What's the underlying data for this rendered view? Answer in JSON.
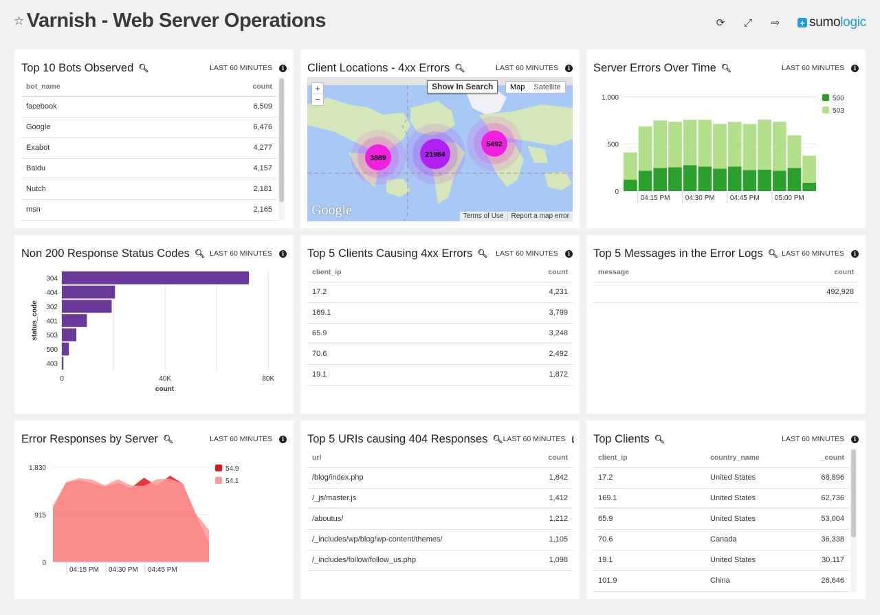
{
  "header": {
    "title": "Varnish - Web Server Operations",
    "star_icon": "star-outline-icon",
    "tools": [
      {
        "name": "refresh",
        "icon": "refresh-icon",
        "glyph": "⟳"
      },
      {
        "name": "fullscreen",
        "icon": "expand-icon",
        "glyph": "⤢"
      },
      {
        "name": "exit",
        "icon": "sign-out-icon",
        "glyph": "⇨"
      }
    ],
    "logo": {
      "prefix": "sumo",
      "suffix": "logic",
      "plus": "+"
    }
  },
  "time_range": "LAST 60 MINUTES",
  "panels": {
    "bots": {
      "title": "Top 10 Bots Observed",
      "columns": [
        "bot_name",
        "count"
      ],
      "rows": [
        [
          "facebook",
          "6,509"
        ],
        [
          "Google",
          "6,476"
        ],
        [
          "Exabot",
          "4,277"
        ],
        [
          "Baidu",
          "4,157"
        ],
        [
          "Nutch",
          "2,181"
        ],
        [
          "msn",
          "2,165"
        ]
      ]
    },
    "map": {
      "title": "Client Locations - 4xx Errors",
      "show_in_search": "Show In Search",
      "map_type": [
        "Map",
        "Satellite"
      ],
      "zoom_in": "+",
      "zoom_out": "−",
      "google": "Google",
      "terms": "Terms of Use",
      "report": "Report a map error",
      "clusters": [
        {
          "label": "3889",
          "color": "#f020e0"
        },
        {
          "label": "21984",
          "color": "#b020f0"
        },
        {
          "label": "5492",
          "color": "#f020e0"
        }
      ]
    },
    "server_errors": {
      "title": "Server Errors Over Time"
    },
    "status_codes": {
      "title": "Non 200 Response Status Codes"
    },
    "clients_4xx": {
      "title": "Top 5 Clients Causing 4xx Errors",
      "columns": [
        "client_ip",
        "count"
      ],
      "rows": [
        [
          "17.2",
          "4,231"
        ],
        [
          "169.1",
          "3,799"
        ],
        [
          "65.9",
          "3,248"
        ],
        [
          "70.6",
          "2,492"
        ],
        [
          "19.1",
          "1,872"
        ]
      ]
    },
    "error_messages": {
      "title": "Top 5 Messages in the Error Logs",
      "columns": [
        "message",
        "count"
      ],
      "rows": [
        [
          "",
          "492,928"
        ]
      ]
    },
    "error_by_server": {
      "title": "Error Responses by Server"
    },
    "uris_404": {
      "title": "Top 5 URIs causing 404 Responses",
      "columns": [
        "url",
        "count"
      ],
      "rows": [
        [
          "/blog/index.php",
          "1,842"
        ],
        [
          "/_js/master.js",
          "1,412"
        ],
        [
          "/aboutus/",
          "1,212"
        ],
        [
          "/_includes/wp/blog/wp-content/themes/",
          "1,105"
        ],
        [
          "/_includes/follow/follow_us.php",
          "1,098"
        ]
      ]
    },
    "top_clients": {
      "title": "Top Clients",
      "columns": [
        "client_ip",
        "country_name",
        "_count"
      ],
      "rows": [
        [
          "17.2",
          "United States",
          "68,896"
        ],
        [
          "169.1",
          "United States",
          "62,736"
        ],
        [
          "65.9",
          "United States",
          "53,004"
        ],
        [
          "70.6",
          "Canada",
          "36,338"
        ],
        [
          "19.1",
          "United States",
          "30,117"
        ],
        [
          "101.9",
          "China",
          "26,646"
        ]
      ]
    }
  },
  "chart_data": [
    {
      "id": "server_errors",
      "type": "bar",
      "stacked": true,
      "title": "Server Errors Over Time",
      "xlabel": "",
      "ylabel": "",
      "ylim": [
        0,
        1000
      ],
      "yticks": [
        "0",
        "500",
        "1,000"
      ],
      "yticks_values": [
        0,
        500,
        1000
      ],
      "xticks": [
        "04:15 PM",
        "04:30 PM",
        "04:45 PM",
        "05:00 PM"
      ],
      "legend": "top-right",
      "series": [
        {
          "name": "500",
          "color": "#2ca02c",
          "values": [
            120,
            215,
            245,
            252,
            275,
            260,
            237,
            260,
            222,
            228,
            215,
            245,
            88
          ]
        },
        {
          "name": "503",
          "color": "#b2df8a",
          "values": [
            290,
            470,
            505,
            483,
            482,
            497,
            476,
            474,
            490,
            530,
            520,
            347,
            287
          ]
        }
      ]
    },
    {
      "id": "status_codes",
      "type": "bar",
      "orientation": "horizontal",
      "title": "Non 200 Response Status Codes",
      "xlabel": "count",
      "ylabel": "status_code",
      "xlim": [
        0,
        85000
      ],
      "xticks": [
        "0",
        "40K",
        "80K"
      ],
      "xticks_values": [
        0,
        40000,
        80000
      ],
      "categories": [
        "304",
        "404",
        "302",
        "401",
        "503",
        "500",
        "403"
      ],
      "values": [
        72500,
        20600,
        19300,
        9700,
        5600,
        2700,
        600
      ],
      "color": "#6a3a9a"
    },
    {
      "id": "error_by_server",
      "type": "area",
      "title": "Error Responses by Server",
      "ylim": [
        0,
        1830
      ],
      "yticks": [
        "0",
        "915",
        "1,830"
      ],
      "yticks_values": [
        0,
        915,
        1830
      ],
      "xticks": [
        "04:15 PM",
        "04:30 PM",
        "04:45 PM"
      ],
      "legend": "top-right",
      "series": [
        {
          "name": "54.9",
          "color": "#e3141b",
          "values": [
            1020,
            1530,
            1580,
            1520,
            1450,
            1530,
            1430,
            1630,
            1470,
            1670,
            1510,
            900,
            380
          ]
        },
        {
          "name": "54.1",
          "color": "#fb9a99",
          "values": [
            1090,
            1540,
            1620,
            1590,
            1480,
            1600,
            1480,
            1470,
            1600,
            1610,
            1510,
            930,
            620
          ]
        }
      ]
    }
  ]
}
